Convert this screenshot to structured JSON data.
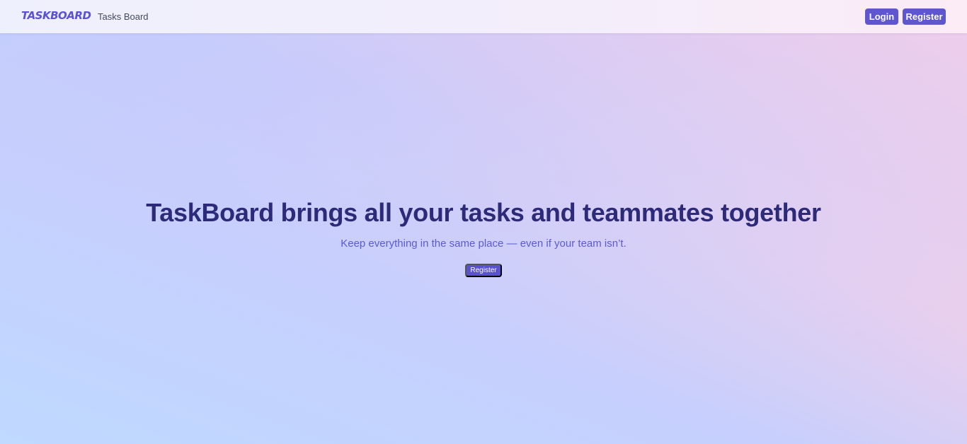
{
  "navbar": {
    "brand": "TASKBOARD",
    "link": "Tasks Board",
    "login_label": "Login",
    "register_label": "Register"
  },
  "hero": {
    "title": "TaskBoard brings all your tasks and teammates together",
    "subtitle": "Keep everything in the same place — even if your team isn’t.",
    "cta_label": "Register"
  },
  "colors": {
    "accent": "#5f55cf",
    "title": "#2d2a7a",
    "subtitle": "#5b5bd0"
  }
}
